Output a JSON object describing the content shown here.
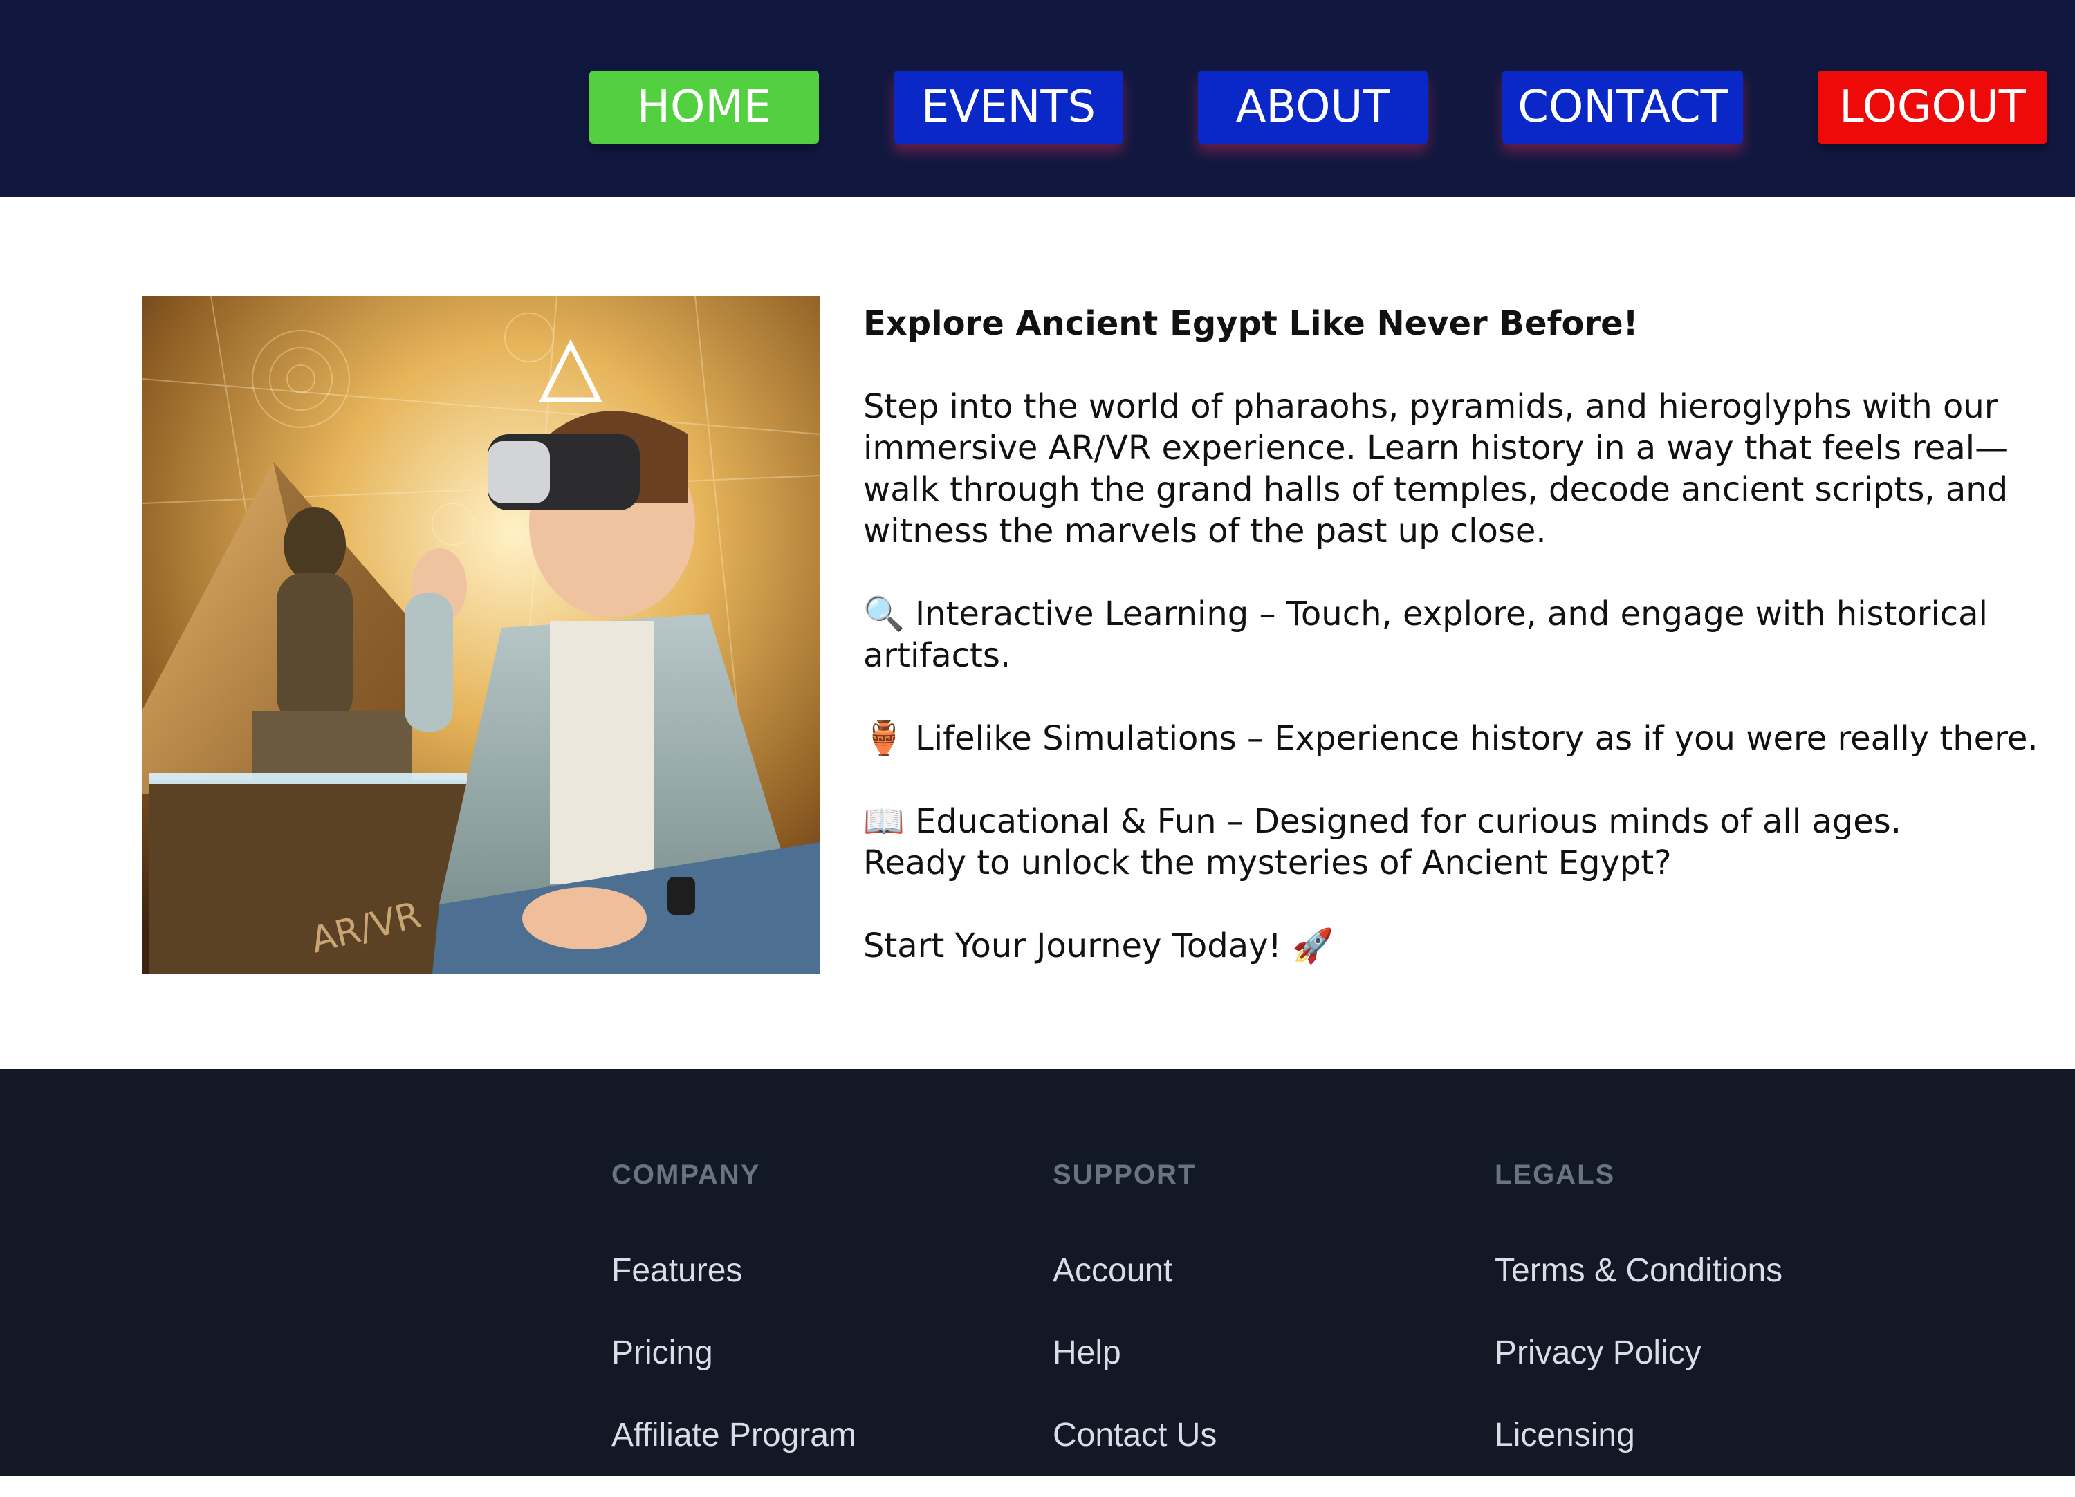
{
  "nav": {
    "home": "HOME",
    "events": "EVENTS",
    "about": "ABOUT",
    "contact": "CONTACT",
    "logout": "LOGOUT"
  },
  "colors": {
    "topbar": "#111840",
    "home_button": "#53d040",
    "nav_button": "#0a27c8",
    "logout_button": "#ef0a0a",
    "footer": "#121826"
  },
  "hero": {
    "image_alt": "AR/VR",
    "heading": "Explore Ancient Egypt Like Never Before!",
    "intro": "Step into the world of pharaohs, pyramids, and hieroglyphs with our immersive AR/VR experience. Learn history in a way that feels real—walk through the grand halls of temples, decode ancient scripts, and witness the marvels of the past up close.",
    "feature1": "🔍 Interactive Learning – Touch, explore, and engage with historical artifacts.",
    "feature2": "🏺 Lifelike Simulations – Experience history as if you were really there.",
    "feature3": "📖 Educational & Fun – Designed for curious minds of all ages.",
    "question": "Ready to unlock the mysteries of Ancient Egypt?",
    "cta": "Start Your Journey Today! 🚀"
  },
  "footer": {
    "company": {
      "title": "COMPANY",
      "links": [
        "Features",
        "Pricing",
        "Affiliate Program"
      ]
    },
    "support": {
      "title": "SUPPORT",
      "links": [
        "Account",
        "Help",
        "Contact Us"
      ]
    },
    "legals": {
      "title": "LEGALS",
      "links": [
        "Terms & Conditions",
        "Privacy Policy",
        "Licensing"
      ]
    }
  }
}
